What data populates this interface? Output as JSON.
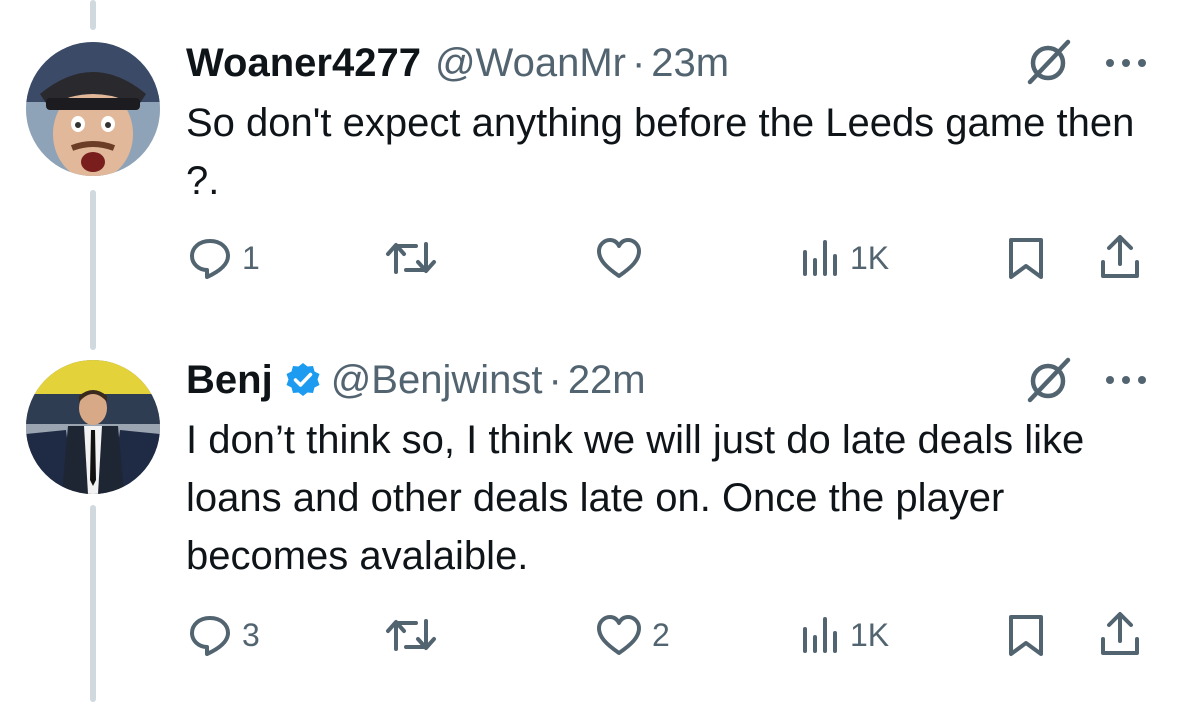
{
  "colors": {
    "text_primary": "#0f1419",
    "text_secondary": "#536471",
    "verified_blue": "#1d9bf0",
    "thread_line": "#cfd9de",
    "background": "#ffffff"
  },
  "tweets": [
    {
      "display_name": "Woaner4277",
      "handle": "@WoanMr",
      "separator": "·",
      "time": "23m",
      "verified": false,
      "text": "So don't expect anything before the Leeds game then ?.",
      "actions": {
        "replies": "1",
        "retweets": "",
        "likes": "",
        "views": "1K"
      },
      "icons": [
        "grok-icon",
        "more-icon",
        "reply-icon",
        "retweet-icon",
        "like-icon",
        "views-icon",
        "bookmark-icon",
        "share-icon"
      ]
    },
    {
      "display_name": "Benj",
      "handle": "@Benjwinst",
      "separator": "·",
      "time": "22m",
      "verified": true,
      "text": "I don’t think so, I think we will just do late deals like loans and other deals late on. Once the player becomes avalaible.",
      "actions": {
        "replies": "3",
        "retweets": "",
        "likes": "2",
        "views": "1K"
      },
      "icons": [
        "verified-badge-icon",
        "grok-icon",
        "more-icon",
        "reply-icon",
        "retweet-icon",
        "like-icon",
        "views-icon",
        "bookmark-icon",
        "share-icon"
      ]
    }
  ]
}
